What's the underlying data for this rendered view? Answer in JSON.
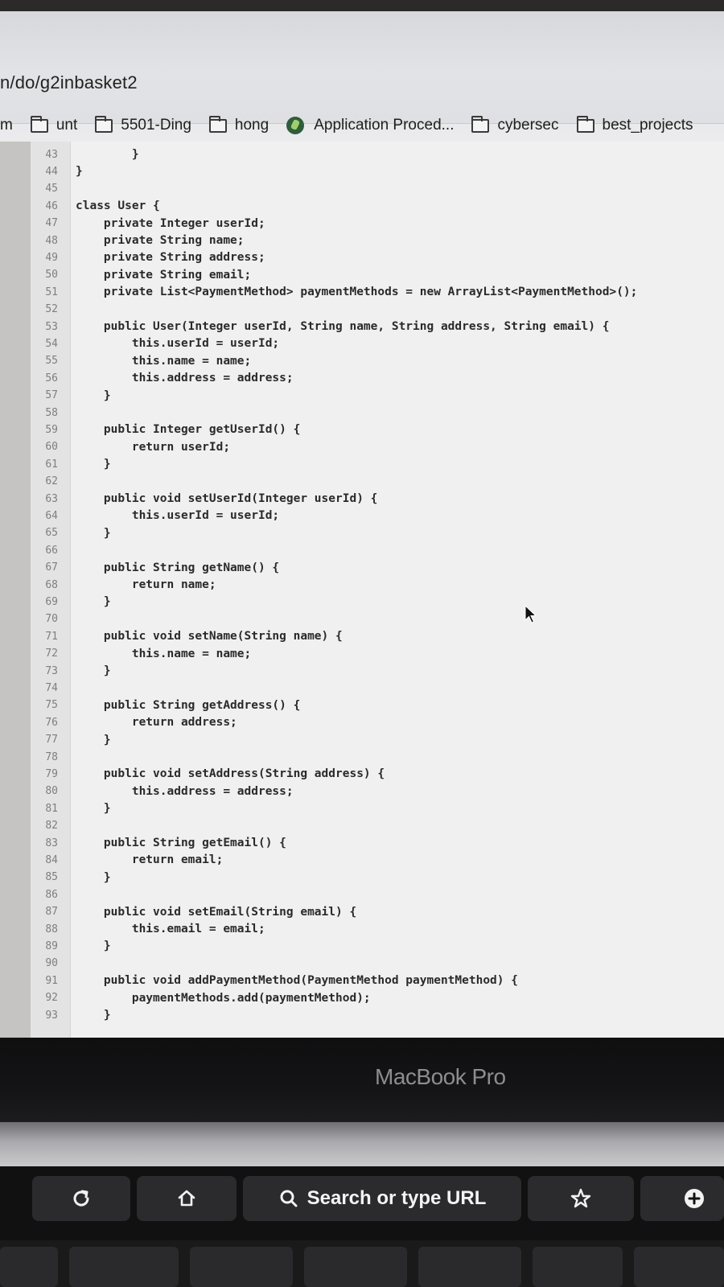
{
  "browser": {
    "url_path": "n/do/g2inbasket2",
    "bookmarks": [
      {
        "label": "m",
        "icon": "none"
      },
      {
        "label": "unt",
        "icon": "folder-icon"
      },
      {
        "label": "5501-Ding",
        "icon": "folder-icon"
      },
      {
        "label": "hong",
        "icon": "folder-icon"
      },
      {
        "label": "Application Proced...",
        "icon": "globe-icon"
      },
      {
        "label": "cybersec",
        "icon": "folder-icon"
      },
      {
        "label": "best_projects",
        "icon": "folder-icon"
      }
    ]
  },
  "editor": {
    "lines": [
      {
        "num": "43",
        "text": "        }"
      },
      {
        "num": "44",
        "text": "}"
      },
      {
        "num": "45",
        "text": ""
      },
      {
        "num": "46",
        "text": "class User {"
      },
      {
        "num": "47",
        "text": "    private Integer userId;"
      },
      {
        "num": "48",
        "text": "    private String name;"
      },
      {
        "num": "49",
        "text": "    private String address;"
      },
      {
        "num": "50",
        "text": "    private String email;"
      },
      {
        "num": "51",
        "text": "    private List<PaymentMethod> paymentMethods = new ArrayList<PaymentMethod>();"
      },
      {
        "num": "52",
        "text": ""
      },
      {
        "num": "53",
        "text": "    public User(Integer userId, String name, String address, String email) {"
      },
      {
        "num": "54",
        "text": "        this.userId = userId;"
      },
      {
        "num": "55",
        "text": "        this.name = name;"
      },
      {
        "num": "56",
        "text": "        this.address = address;"
      },
      {
        "num": "57",
        "text": "    }"
      },
      {
        "num": "58",
        "text": ""
      },
      {
        "num": "59",
        "text": "    public Integer getUserId() {"
      },
      {
        "num": "60",
        "text": "        return userId;"
      },
      {
        "num": "61",
        "text": "    }"
      },
      {
        "num": "62",
        "text": ""
      },
      {
        "num": "63",
        "text": "    public void setUserId(Integer userId) {"
      },
      {
        "num": "64",
        "text": "        this.userId = userId;"
      },
      {
        "num": "65",
        "text": "    }"
      },
      {
        "num": "66",
        "text": ""
      },
      {
        "num": "67",
        "text": "    public String getName() {"
      },
      {
        "num": "68",
        "text": "        return name;"
      },
      {
        "num": "69",
        "text": "    }"
      },
      {
        "num": "70",
        "text": ""
      },
      {
        "num": "71",
        "text": "    public void setName(String name) {"
      },
      {
        "num": "72",
        "text": "        this.name = name;"
      },
      {
        "num": "73",
        "text": "    }"
      },
      {
        "num": "74",
        "text": ""
      },
      {
        "num": "75",
        "text": "    public String getAddress() {"
      },
      {
        "num": "76",
        "text": "        return address;"
      },
      {
        "num": "77",
        "text": "    }"
      },
      {
        "num": "78",
        "text": ""
      },
      {
        "num": "79",
        "text": "    public void setAddress(String address) {"
      },
      {
        "num": "80",
        "text": "        this.address = address;"
      },
      {
        "num": "81",
        "text": "    }"
      },
      {
        "num": "82",
        "text": ""
      },
      {
        "num": "83",
        "text": "    public String getEmail() {"
      },
      {
        "num": "84",
        "text": "        return email;"
      },
      {
        "num": "85",
        "text": "    }"
      },
      {
        "num": "86",
        "text": ""
      },
      {
        "num": "87",
        "text": "    public void setEmail(String email) {"
      },
      {
        "num": "88",
        "text": "        this.email = email;"
      },
      {
        "num": "89",
        "text": "    }"
      },
      {
        "num": "90",
        "text": ""
      },
      {
        "num": "91",
        "text": "    public void addPaymentMethod(PaymentMethod paymentMethod) {"
      },
      {
        "num": "92",
        "text": "        paymentMethods.add(paymentMethod);"
      },
      {
        "num": "93",
        "text": "    }"
      }
    ]
  },
  "laptop": {
    "brand": "MacBook Pro"
  },
  "touchbar": {
    "reload_icon": "reload-icon",
    "home_icon": "home-icon",
    "search_label": "Search or type URL",
    "star_icon": "star-icon",
    "new_tab_icon": "plus-icon"
  }
}
